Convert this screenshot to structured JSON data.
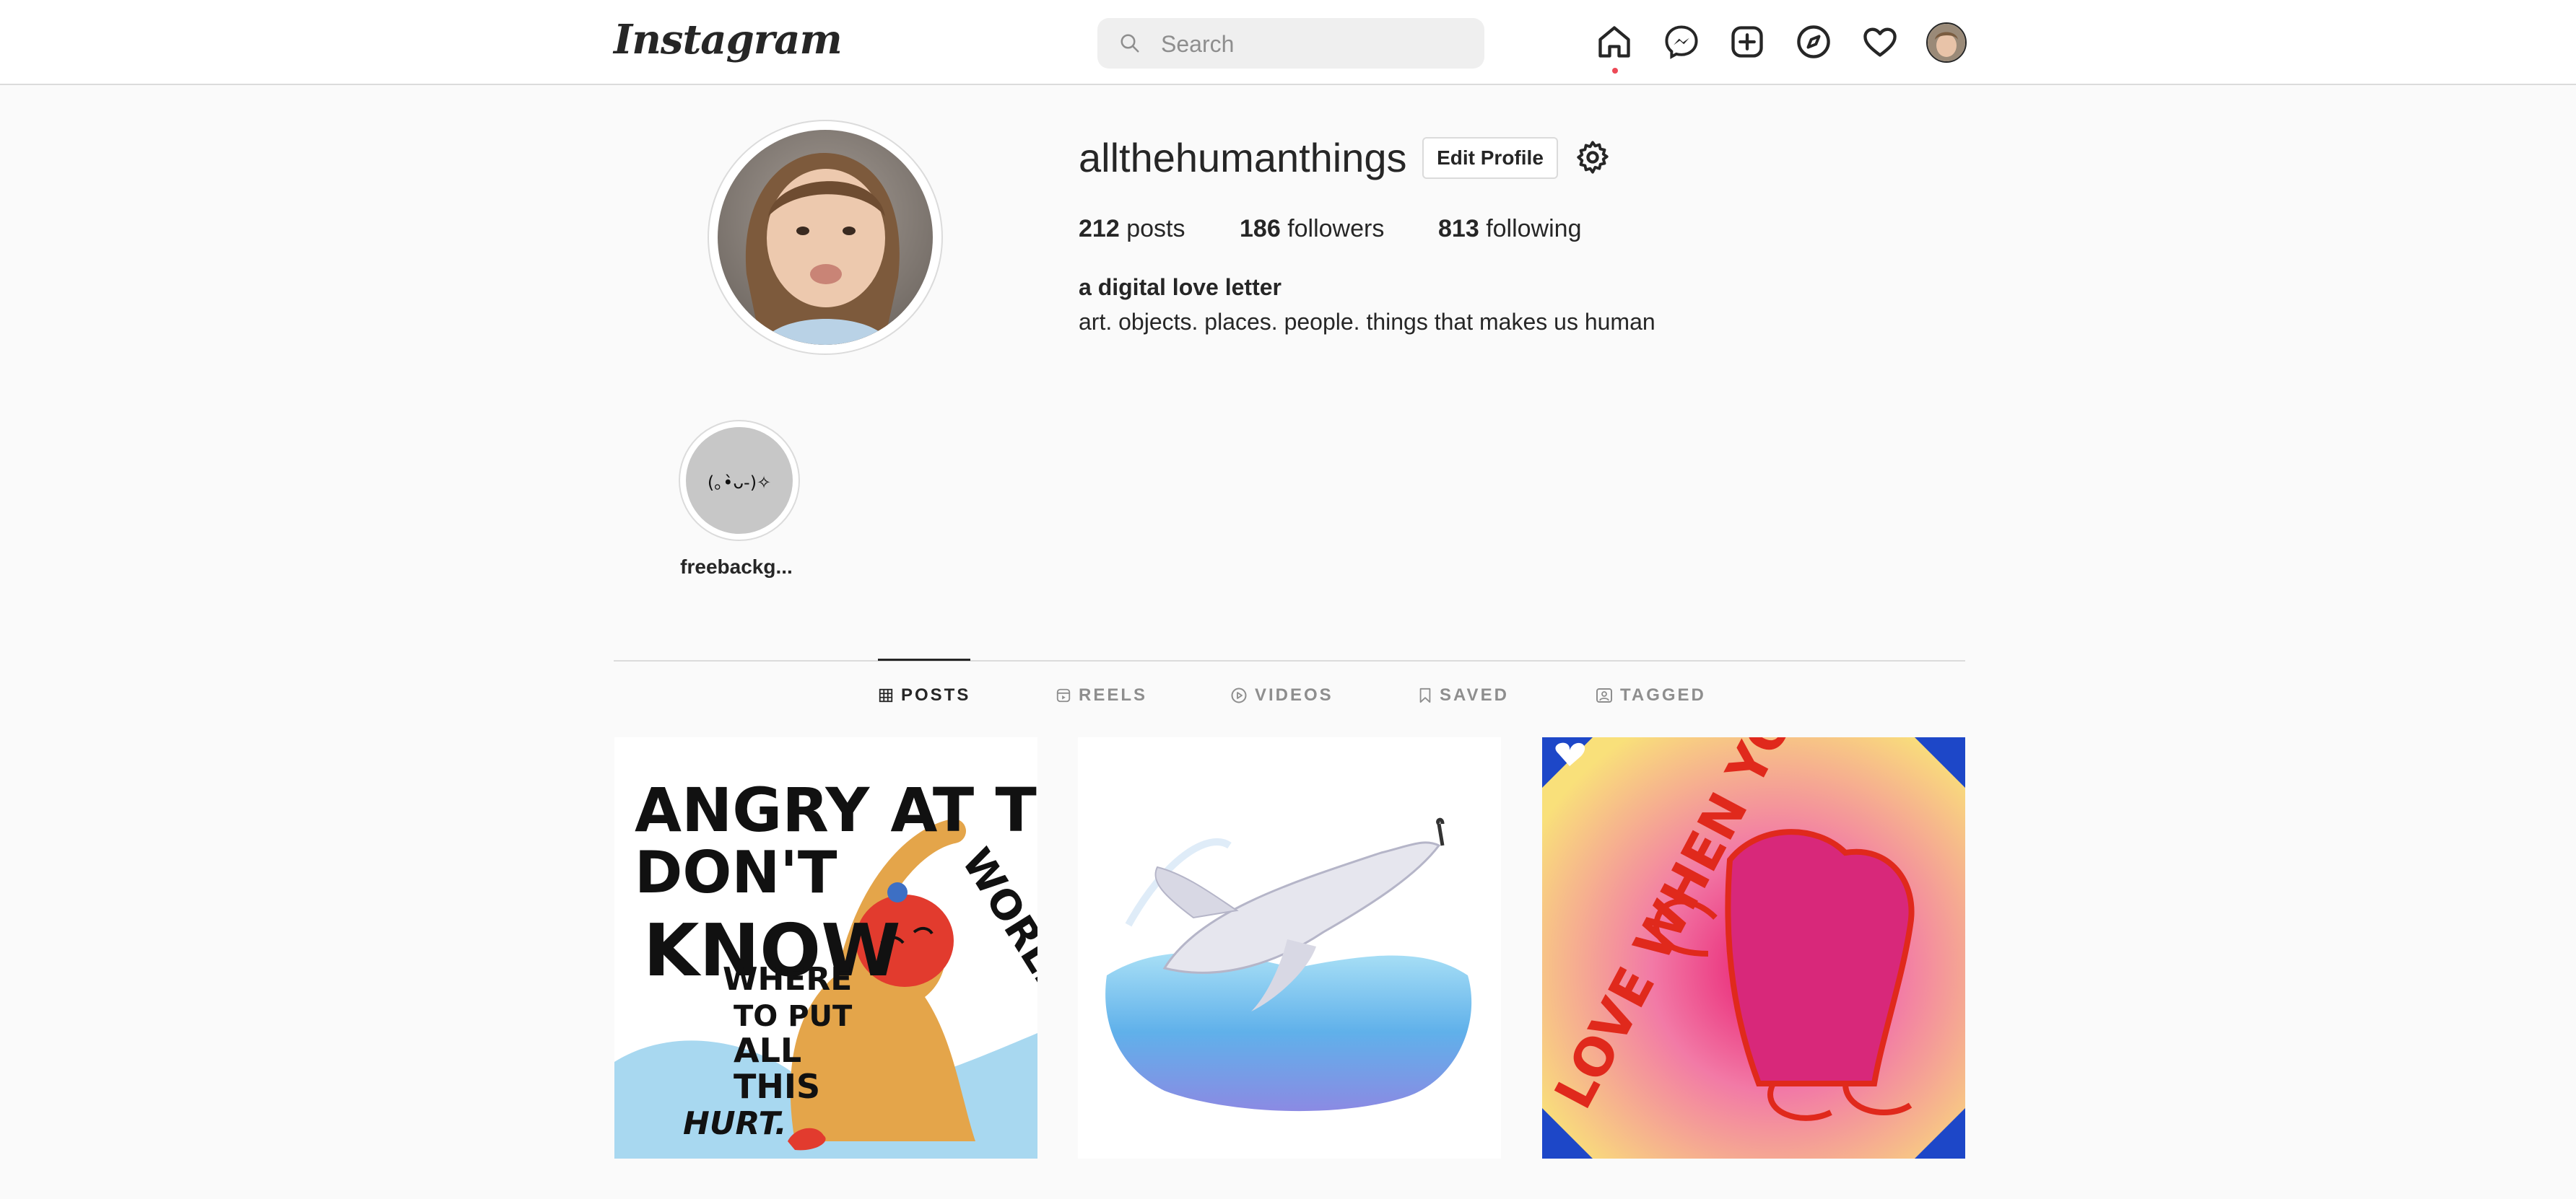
{
  "header": {
    "logo": "Instagram",
    "search_placeholder": "Search",
    "nav_icons": [
      "home-icon",
      "messenger-icon",
      "new-post-icon",
      "explore-icon",
      "activity-heart-icon",
      "profile-avatar"
    ]
  },
  "profile": {
    "username": "allthehumanthings",
    "edit_label": "Edit Profile",
    "stats": [
      {
        "value": "212",
        "label": "posts"
      },
      {
        "value": "186",
        "label": "followers"
      },
      {
        "value": "813",
        "label": "following"
      }
    ],
    "bio_name": "a digital love letter",
    "bio_text": "art. objects. places. people. things that makes us human"
  },
  "highlights": [
    {
      "cover_text": "(｡•̀ᴗ-)✧",
      "label": "freebackg..."
    }
  ],
  "tabs": [
    {
      "label": "POSTS",
      "icon": "grid-icon",
      "active": true
    },
    {
      "label": "REELS",
      "icon": "reels-icon",
      "active": false
    },
    {
      "label": "VIDEOS",
      "icon": "play-icon",
      "active": false
    },
    {
      "label": "SAVED",
      "icon": "bookmark-icon",
      "active": false
    },
    {
      "label": "TAGGED",
      "icon": "tag-icon",
      "active": false
    }
  ],
  "posts": [
    {
      "lines": [
        "ANGRY AT THE",
        "WORLD",
        "DON'T",
        "KNOW",
        "WHERE",
        "TO PUT",
        "ALL",
        "THIS",
        "HURT."
      ]
    },
    {},
    {
      "text": "LOVE WHEN YOU HAVE IT"
    }
  ]
}
